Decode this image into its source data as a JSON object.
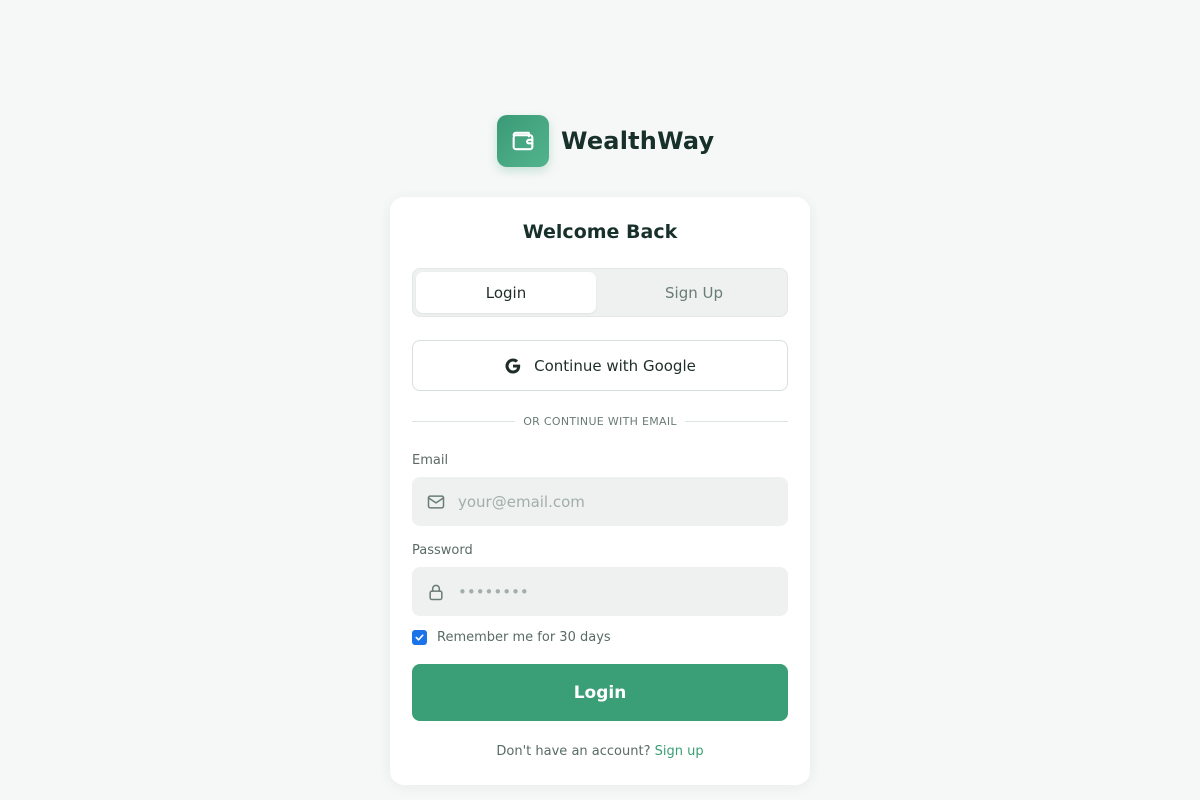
{
  "brand": {
    "name": "WealthWay",
    "logo_icon": "wallet-icon",
    "accent": "#3a9e76"
  },
  "card": {
    "title": "Welcome Back",
    "tabs": [
      {
        "label": "Login",
        "active": true
      },
      {
        "label": "Sign Up",
        "active": false
      }
    ],
    "google_button": {
      "label": "Continue with Google",
      "icon": "google-icon"
    },
    "divider_text": "OR CONTINUE WITH EMAIL",
    "email": {
      "label": "Email",
      "placeholder": "your@email.com",
      "value": "",
      "icon": "mail-icon"
    },
    "password": {
      "label": "Password",
      "placeholder": "••••••••",
      "value": "",
      "icon": "lock-icon"
    },
    "remember": {
      "label": "Remember me for 30 days",
      "checked": true
    },
    "login_button": {
      "label": "Login"
    },
    "footer": {
      "text": "Don't have an account?",
      "link": "Sign up"
    }
  }
}
